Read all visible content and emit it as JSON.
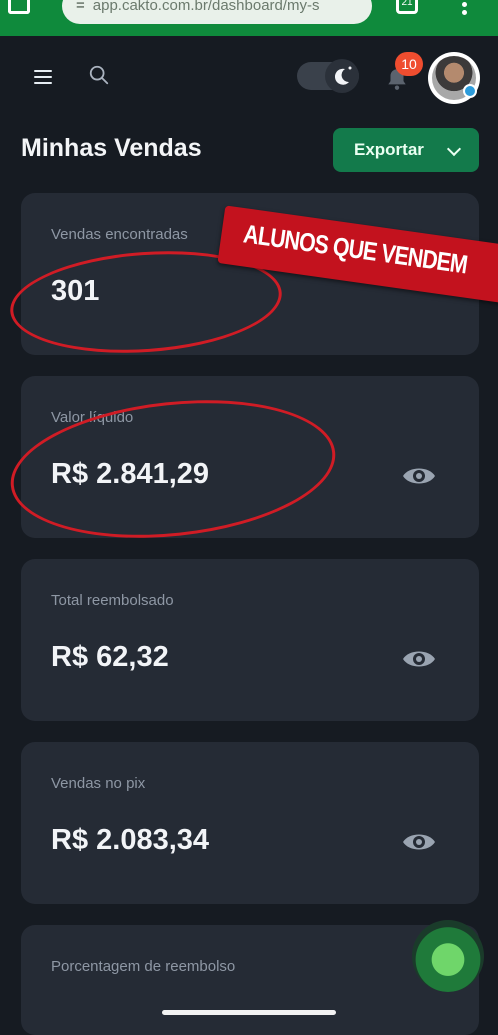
{
  "browser": {
    "url": "app.cakto.com.br/dashboard/my-s",
    "tab_count": "21"
  },
  "header": {
    "notification_count": "10"
  },
  "page": {
    "title": "Minhas Vendas",
    "export_label": "Exportar"
  },
  "cards": [
    {
      "label": "Vendas encontradas",
      "value": "301"
    },
    {
      "label": "Valor líquido",
      "value": "R$ 2.841,29"
    },
    {
      "label": "Total reembolsado",
      "value": "R$ 62,32"
    },
    {
      "label": "Vendas no pix",
      "value": "R$ 2.083,34"
    },
    {
      "label": "Porcentagem de reembolso",
      "value": ""
    }
  ],
  "overlay": {
    "sticker_text": "ALUNOS QUE VENDEM"
  },
  "colors": {
    "accent": "#137a4b",
    "browser_bar": "#0f8a3c",
    "badge": "#ef4d2f",
    "annotation": "#d01c25"
  }
}
